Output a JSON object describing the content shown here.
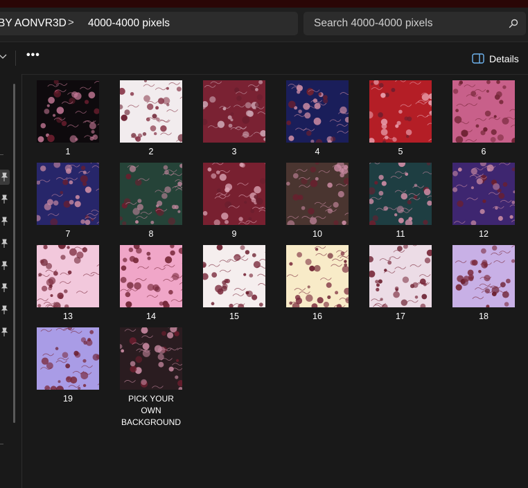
{
  "address_bar": {
    "crumbs": [
      "BY AONVR3D",
      "4000-4000 pixels"
    ],
    "separator": ">"
  },
  "search": {
    "placeholder": "Search 4000-4000 pixels",
    "icon": "search-icon"
  },
  "toolbar": {
    "more_label": "•••",
    "details_label": "Details"
  },
  "files": [
    {
      "name": "1",
      "bg": "#0e0a0d",
      "accent": "#c77a98"
    },
    {
      "name": "2",
      "bg": "#f2ecee",
      "accent": "#8a3a4c"
    },
    {
      "name": "3",
      "bg": "#7a2233",
      "accent": "#c9a0ae"
    },
    {
      "name": "4",
      "bg": "#1a1e5a",
      "accent": "#c98aa2"
    },
    {
      "name": "5",
      "bg": "#b41e26",
      "accent": "#e8a0ae"
    },
    {
      "name": "6",
      "bg": "#c8608a",
      "accent": "#7a2a3c"
    },
    {
      "name": "7",
      "bg": "#27266a",
      "accent": "#c98aa2"
    },
    {
      "name": "8",
      "bg": "#254338",
      "accent": "#c98aa2"
    },
    {
      "name": "9",
      "bg": "#782030",
      "accent": "#d8a0b0"
    },
    {
      "name": "10",
      "bg": "#4a3530",
      "accent": "#c98aa2"
    },
    {
      "name": "11",
      "bg": "#1e3e42",
      "accent": "#c98aa2"
    },
    {
      "name": "12",
      "bg": "#3e2670",
      "accent": "#c98aa2"
    },
    {
      "name": "13",
      "bg": "#f2c8dc",
      "accent": "#7a2a3c"
    },
    {
      "name": "14",
      "bg": "#f0a6c8",
      "accent": "#7a2a3c"
    },
    {
      "name": "15",
      "bg": "#f5eeee",
      "accent": "#7a2a3c"
    },
    {
      "name": "16",
      "bg": "#f8ebc8",
      "accent": "#7a2a3c"
    },
    {
      "name": "17",
      "bg": "#ecdce6",
      "accent": "#7a2a3c"
    },
    {
      "name": "18",
      "bg": "#c8b0e6",
      "accent": "#7a2a3c"
    },
    {
      "name": "19",
      "bg": "#a99ce6",
      "accent": "#7a2a3c"
    },
    {
      "name": "PICK YOUR OWN BACKGROUND",
      "bg": "#2a1c20",
      "accent": "#c98aa2",
      "lines": [
        "PICK YOUR",
        "OWN",
        "BACKGROUND"
      ]
    }
  ]
}
